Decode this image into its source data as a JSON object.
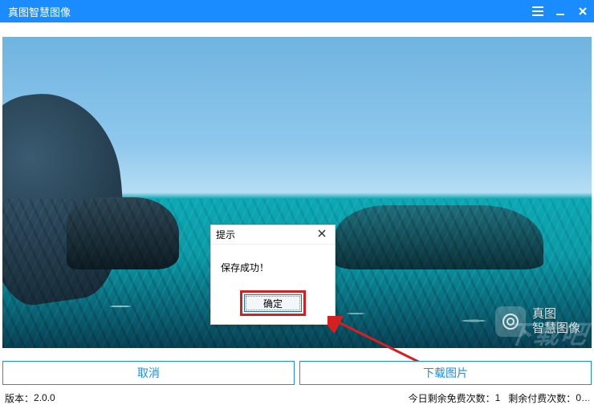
{
  "titlebar": {
    "title": "真图智慧图像"
  },
  "watermark": {
    "line1": "真图",
    "line2": "智慧图像"
  },
  "corner_mark": "下载吧",
  "dialog": {
    "title": "提示",
    "message": "保存成功！",
    "ok_label": "确定"
  },
  "buttons": {
    "cancel": "取消",
    "download": "下载图片"
  },
  "status": {
    "version_label": "版本：",
    "version_value": "2.0.0",
    "free_label": "今日剩余免费次数：",
    "free_value": "1",
    "paid_label": "剩余付费次数：",
    "paid_value": "0"
  }
}
